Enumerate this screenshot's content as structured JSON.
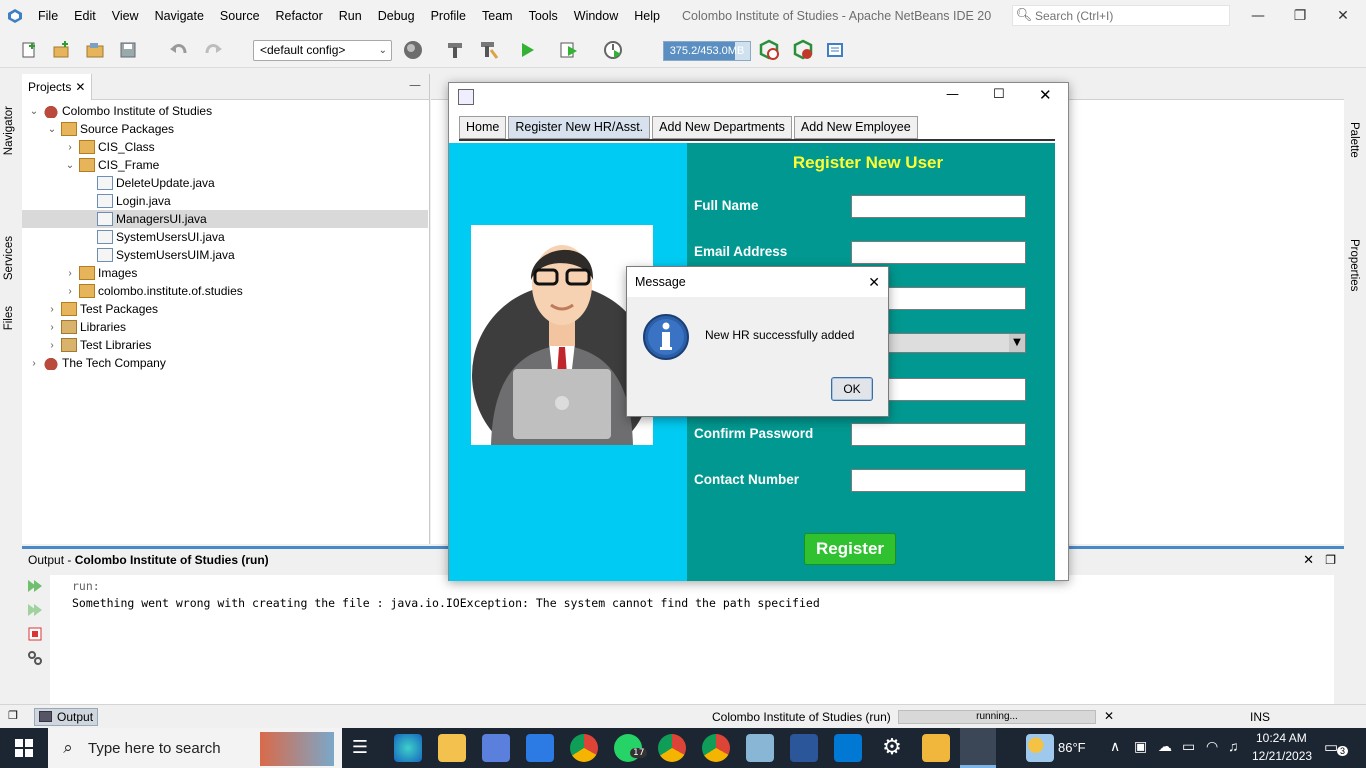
{
  "menubar": {
    "items": [
      "File",
      "Edit",
      "View",
      "Navigate",
      "Source",
      "Refactor",
      "Run",
      "Debug",
      "Profile",
      "Team",
      "Tools",
      "Window",
      "Help"
    ],
    "window_title": "Colombo Institute of Studies - Apache NetBeans IDE 20",
    "search_placeholder": "Search (Ctrl+I)"
  },
  "toolbar": {
    "config_value": "<default config>",
    "memory_text": "375.2/453.0MB",
    "memory_fraction": 0.83
  },
  "side_tabs": {
    "left": [
      "Navigator",
      "Services",
      "Files"
    ],
    "right": [
      "Palette",
      "Properties"
    ]
  },
  "projects": {
    "tab_label": "Projects",
    "tree": [
      {
        "label": "Colombo Institute of Studies",
        "depth": 0,
        "icon": "coffee-project-icon",
        "toggle": "expanded"
      },
      {
        "label": "Source Packages",
        "depth": 1,
        "icon": "folder-package-icon",
        "toggle": "expanded"
      },
      {
        "label": "CIS_Class",
        "depth": 2,
        "icon": "package-icon",
        "toggle": "collapsed"
      },
      {
        "label": "CIS_Frame",
        "depth": 2,
        "icon": "package-icon",
        "toggle": "expanded"
      },
      {
        "label": "DeleteUpdate.java",
        "depth": 3,
        "icon": "java-file-icon",
        "toggle": "none"
      },
      {
        "label": "Login.java",
        "depth": 3,
        "icon": "java-file-icon",
        "toggle": "none"
      },
      {
        "label": "ManagersUI.java",
        "depth": 3,
        "icon": "java-file-icon",
        "toggle": "none",
        "selected": true
      },
      {
        "label": "SystemUsersUI.java",
        "depth": 3,
        "icon": "java-file-icon",
        "toggle": "none"
      },
      {
        "label": "SystemUsersUIM.java",
        "depth": 3,
        "icon": "java-file-icon",
        "toggle": "none"
      },
      {
        "label": "Images",
        "depth": 2,
        "icon": "package-icon",
        "toggle": "collapsed"
      },
      {
        "label": "colombo.institute.of.studies",
        "depth": 2,
        "icon": "package-icon",
        "toggle": "collapsed"
      },
      {
        "label": "Test Packages",
        "depth": 1,
        "icon": "folder-package-icon",
        "toggle": "collapsed"
      },
      {
        "label": "Libraries",
        "depth": 1,
        "icon": "library-icon",
        "toggle": "collapsed"
      },
      {
        "label": "Test Libraries",
        "depth": 1,
        "icon": "library-icon",
        "toggle": "collapsed"
      },
      {
        "label": "The Tech Company",
        "depth": 0,
        "icon": "coffee-project-icon",
        "toggle": "collapsed"
      }
    ]
  },
  "output": {
    "title_prefix": "Output - ",
    "title_bold": "Colombo Institute of Studies (run)",
    "lines": [
      "run:",
      "Something went wrong with creating the file : java.io.IOException: The system cannot find the path specified"
    ]
  },
  "statusbar": {
    "output_tab": "Output",
    "process_name": "Colombo Institute of Studies (run)",
    "progress_text": "running...",
    "insert_mode": "INS"
  },
  "app_window": {
    "tabs": [
      "Home",
      "Register New HR/Asst.",
      "Add New Departments",
      "Add New Employee"
    ],
    "active_tab_index": 1,
    "heading": "Register New User",
    "labels": {
      "full_name": "Full Name",
      "email": "Email Address",
      "confirm_password": "Confirm Password",
      "contact": "Contact Number"
    },
    "register_button": "Register",
    "colors": {
      "left_panel": "#00cbf2",
      "right_panel": "#009890",
      "heading": "#ffff33",
      "register": "#2fc12f"
    }
  },
  "dialog": {
    "title": "Message",
    "message": "New HR  successfully added",
    "ok_label": "OK",
    "icon": "info-icon"
  },
  "taskbar": {
    "search_placeholder": "Type here to search",
    "weather": "86°F",
    "time": "10:24 AM",
    "date": "12/21/2023",
    "whatsapp_badge": "17",
    "notification_count": "3"
  }
}
